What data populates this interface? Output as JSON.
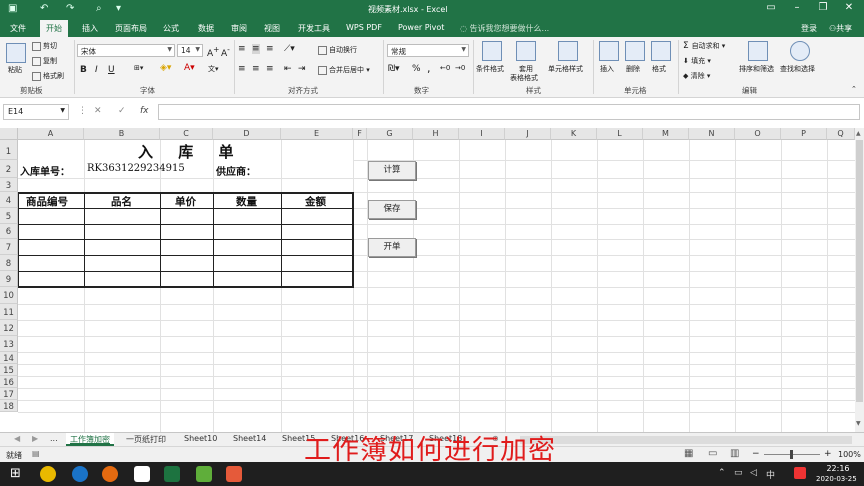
{
  "window": {
    "title": "视频素材.xlsx - Excel"
  },
  "menu": {
    "tabs": [
      "文件",
      "开始",
      "插入",
      "页面布局",
      "公式",
      "数据",
      "审阅",
      "视图",
      "开发工具",
      "WPS PDF",
      "Power Pivot"
    ],
    "search_hint": "告诉我您想要做什么...",
    "login": "登录",
    "share": "共享"
  },
  "ribbon": {
    "clipboard": {
      "paste": "粘贴",
      "cut": "剪切",
      "copy": "复制",
      "painter": "格式刷",
      "group": "剪贴板"
    },
    "font": {
      "name": "宋体",
      "size": "14",
      "bold": "B",
      "italic": "I",
      "underline": "U",
      "group": "字体"
    },
    "alignment": {
      "wrap": "自动换行",
      "merge": "合并后居中",
      "group": "对齐方式"
    },
    "number": {
      "format": "常规",
      "percent": "%",
      "comma": ",",
      "group": "数字"
    },
    "styles": {
      "cond": "条件格式",
      "table_l1": "套用",
      "table_l2": "表格格式",
      "cell": "单元格样式",
      "group": "样式"
    },
    "cells": {
      "insert": "插入",
      "delete": "删除",
      "format": "格式",
      "group": "单元格"
    },
    "editing": {
      "autosum": "自动求和",
      "fill": "填充",
      "clear": "清除",
      "sort": "排序和筛选",
      "find": "查找和选择",
      "group": "编辑"
    }
  },
  "formula_bar": {
    "name_box": "E14",
    "fx": "fx",
    "value": ""
  },
  "columns": [
    "A",
    "B",
    "C",
    "D",
    "E",
    "F",
    "G",
    "H",
    "I",
    "J",
    "K",
    "L",
    "M",
    "N",
    "O",
    "P",
    "Q"
  ],
  "rows": [
    "1",
    "2",
    "3",
    "4",
    "5",
    "6",
    "7",
    "8",
    "9",
    "10",
    "11",
    "12",
    "13",
    "14",
    "15",
    "16",
    "17",
    "18"
  ],
  "sheet": {
    "title": "入 库 单",
    "order_label": "入库单号：",
    "order_no": "RK3631229234915",
    "supplier_label": "供应商：",
    "headers": [
      "商品编号",
      "品名",
      "单价",
      "数量",
      "金额"
    ]
  },
  "buttons": {
    "calc": "计算",
    "save": "保存",
    "open": "开单"
  },
  "tabs": {
    "items": [
      "工作簿加密",
      "一页纸打印",
      "Sheet10",
      "Sheet14",
      "Sheet15",
      "Sheet16",
      "Sheet17",
      "Sheet18"
    ],
    "dots": "..."
  },
  "status": {
    "ready": "就绪",
    "zoom": "100%"
  },
  "caption": "工作簿如何进行加密",
  "clock": {
    "time": "22:16",
    "date": "2020-03-25"
  },
  "colors": {
    "excel_green": "#217346",
    "caption_red": "#e01c1c"
  }
}
